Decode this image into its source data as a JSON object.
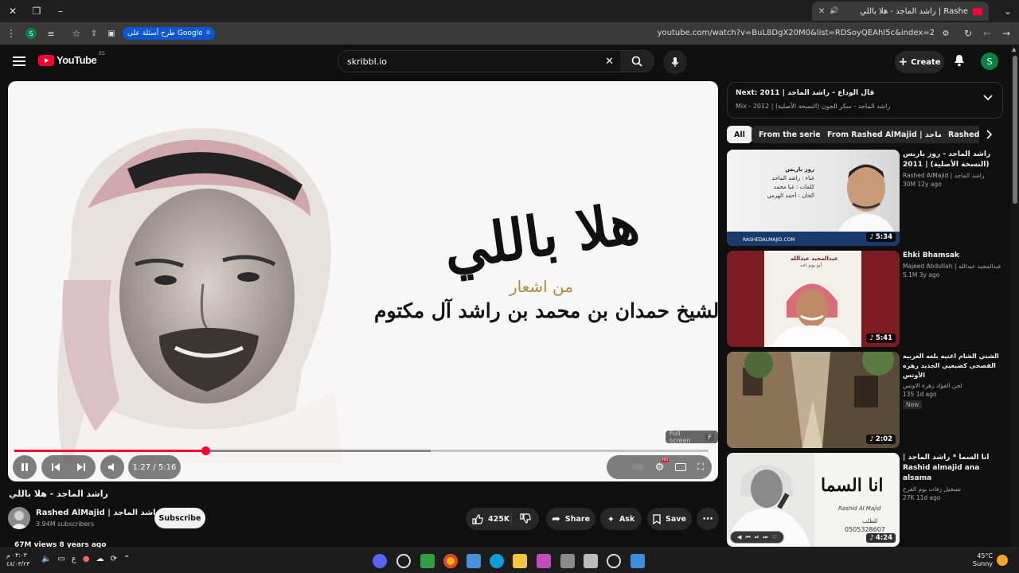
{
  "browser": {
    "tab_title": "راشد الماجد - هلا باللي | Rashe",
    "url": "youtube.com/watch?v=BuL8DgX20M0&list=RDSoyQEAhI5c&index=2",
    "google_pill": "طرح أسئلة على Google",
    "profile_initial": "S"
  },
  "header": {
    "logo_text": "YouTube",
    "country": "ES",
    "search_value": "skribbl.io",
    "create_label": "Create",
    "avatar_initial": "S"
  },
  "player": {
    "art_line1": "هلا باللي",
    "art_line2": "من اشعار",
    "art_line3": "سمو الشيخ حمدان بن محمد بن راشد آل مكتوم",
    "time": "1:27 / 5:16",
    "progress": 0.275,
    "buffered": 0.6,
    "tooltip_label": "Full screen",
    "tooltip_key": "F",
    "hd_badge": "HD"
  },
  "video": {
    "title": "راشد الماجد - هلا باللي",
    "channel": "Rashed AlMajid | راشد الماجد",
    "subscribers": "3.94M subscribers",
    "subscribe_label": "Subscribe",
    "likes": "425K",
    "share_label": "Share",
    "ask_label": "Ask",
    "save_label": "Save",
    "views_line": "67M views  8 years ago"
  },
  "next": {
    "title": "Next: 2011 | قال الوداع - راشد الماجد",
    "subtitle": "Mix - 2012 | راشد الماجد - سكر الجون (النسخة الأصلية)"
  },
  "chips": [
    "All",
    "From the series",
    "From Rashed AlMajid | راشد الماجد",
    "Rashed"
  ],
  "recommendations": [
    {
      "title": "راشد الماجد - روز باريس (النسخة الأصلية) | 2011",
      "channel": "Rashed AlMajid | راشد الماجد",
      "stats": "30M  12y ago",
      "duration": "5:34",
      "badge": "",
      "thumb_text1": "روز باريس",
      "thumb_text2": "غناء : راشد الماجد",
      "thumb_text3": "كلمات : غيا محمد",
      "thumb_text4": "الحان : أحمد الهرمي",
      "thumb_footer": "RASHEDALMAJID.COM"
    },
    {
      "title": "Ehki Bhamsak",
      "channel": "Majeed Abdullah | عبدالمجيد عبدالله",
      "stats": "5.1M  3y ago",
      "duration": "5:41",
      "badge": "",
      "thumb_text1": "عبدالمجيد عبدالله",
      "thumb_text2": "أبو يوم احد",
      "thumb_text3": "",
      "thumb_text4": "",
      "thumb_footer": ""
    },
    {
      "title": "الشتي الشام اغنيه بلغه العربيه الفصحى كصبعيي الجديد زهره الأوتس",
      "channel": "لحن الفؤاد زهرة الاوتس",
      "stats": "135  1d ago",
      "duration": "2:02",
      "badge": "New",
      "thumb_text1": "",
      "thumb_text2": "",
      "thumb_text3": "",
      "thumb_text4": "",
      "thumb_footer": ""
    },
    {
      "title": "انا السما * راشد الماجد | Rashid almajid ana alsama",
      "channel": "تسجيل زفات يوم الفرح",
      "stats": "27K  11d ago",
      "duration": "4:24",
      "badge": "",
      "thumb_text1": "انا السما",
      "thumb_text2": "Rashid Al Majid",
      "thumb_text3": "للطلب",
      "thumb_text4": "0505328607",
      "thumb_footer": ""
    }
  ],
  "taskbar": {
    "time": "٠٣:٠٣ م",
    "date": "٤٨/٠٣/٢٣",
    "lang": "ع",
    "temp": "45°C",
    "weather": "Sunny"
  },
  "colors": {
    "accent": "#ff0033",
    "background": "#0f0f0f",
    "chip": "#272727"
  }
}
